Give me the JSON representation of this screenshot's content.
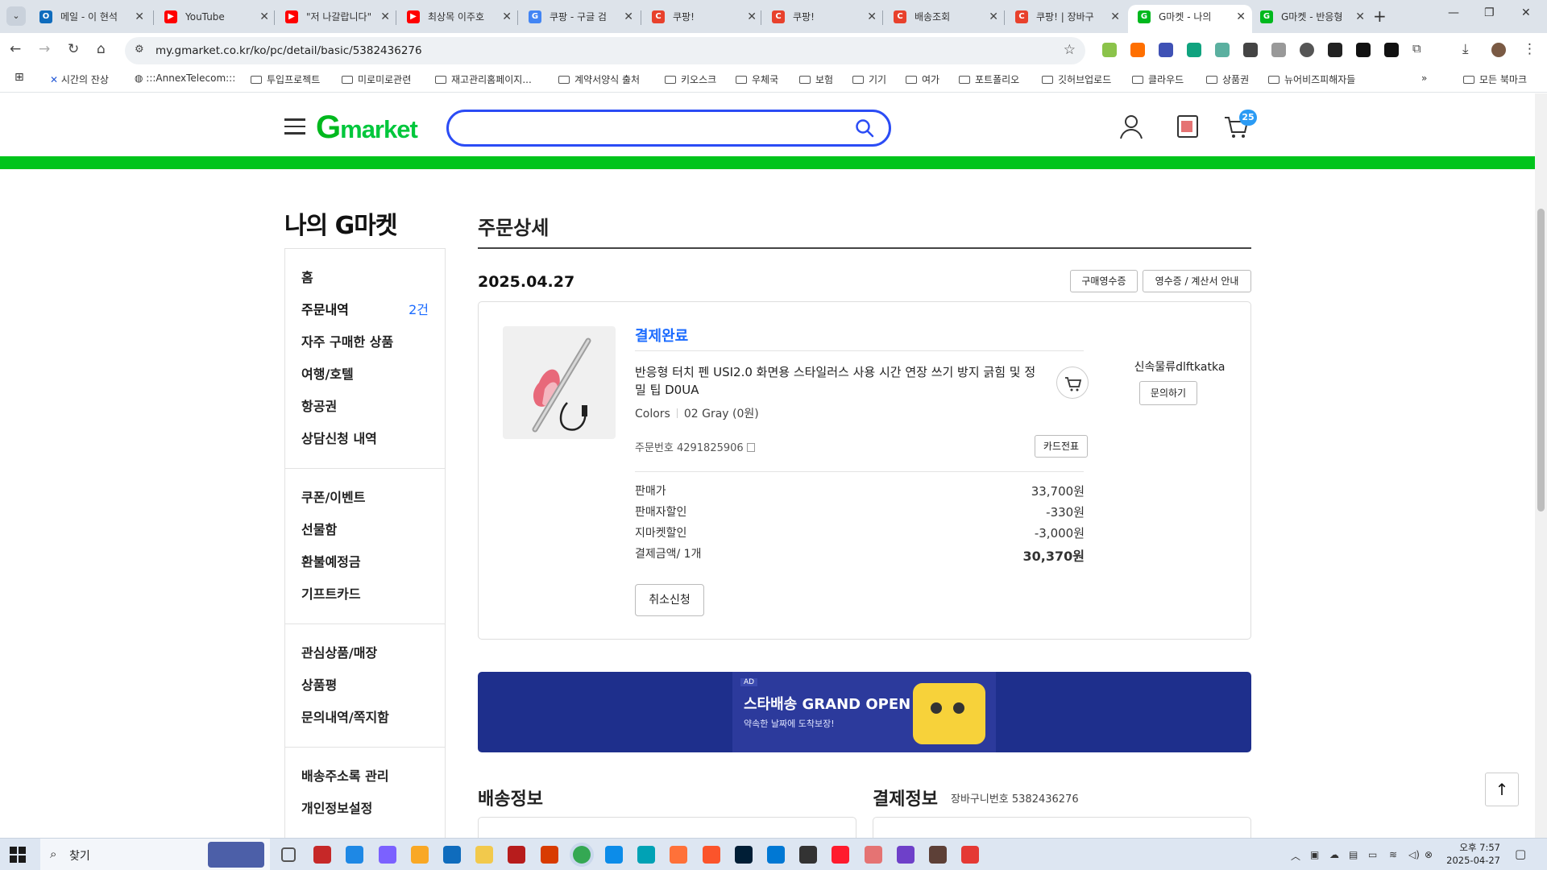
{
  "browser": {
    "tabs": [
      {
        "title": "메일 - 이 현석",
        "fav": "O",
        "color": "#0f6cbd"
      },
      {
        "title": "YouTube",
        "fav": "▶",
        "color": "#ff0000"
      },
      {
        "title": "\"저 나갈랍니다\"",
        "fav": "▶",
        "color": "#ff0000"
      },
      {
        "title": "최상목 이주호",
        "fav": "▶",
        "color": "#ff0000"
      },
      {
        "title": "쿠팡 - 구글 검",
        "fav": "G",
        "color": "#4285f4"
      },
      {
        "title": "쿠팡!",
        "fav": "C",
        "color": "#e8412c"
      },
      {
        "title": "쿠팡!",
        "fav": "C",
        "color": "#e8412c"
      },
      {
        "title": "배송조회",
        "fav": "C",
        "color": "#e8412c"
      },
      {
        "title": "쿠팡! | 장바구",
        "fav": "C",
        "color": "#e8412c"
      },
      {
        "title": "G마켓 - 나의 ",
        "fav": "G",
        "color": "#00b81d"
      },
      {
        "title": "G마켓 - 반응형",
        "fav": "G",
        "color": "#00b81d"
      }
    ],
    "url": "my.gmarket.co.kr/ko/pc/detail/basic/5382436276",
    "bookmarks": [
      "시간의 잔상",
      ":::AnnexTelecom:::",
      "투입프로젝트",
      "미로미로관련",
      "재고관리홈페이지...",
      "계약서양식 출처",
      "키오스크",
      "우체국",
      "보험",
      "기기",
      "여가",
      "포트폴리오",
      "깃허브업로드",
      "클라우드",
      "상품권",
      "뉴어비즈피해자들"
    ],
    "all_bookmarks": "모든 북마크"
  },
  "header": {
    "logo": "Gmarket",
    "search_placeholder": "",
    "cart_count": "25"
  },
  "sidebar": {
    "title": "나의 G마켓",
    "groups": [
      [
        {
          "label": "홈"
        },
        {
          "label": "주문내역",
          "count": "2건"
        },
        {
          "label": "자주 구매한 상품"
        },
        {
          "label": "여행/호텔"
        },
        {
          "label": "항공권"
        },
        {
          "label": "상담신청 내역"
        }
      ],
      [
        {
          "label": "쿠폰/이벤트"
        },
        {
          "label": "선물함"
        },
        {
          "label": "환불예정금"
        },
        {
          "label": "기프트카드"
        }
      ],
      [
        {
          "label": "관심상품/매장"
        },
        {
          "label": "상품평"
        },
        {
          "label": "문의내역/쪽지함"
        }
      ],
      [
        {
          "label": "배송주소록 관리"
        },
        {
          "label": "개인정보설정"
        }
      ]
    ]
  },
  "order": {
    "page_title": "주문상세",
    "date": "2025.04.27",
    "receipt_btn": "구매영수증",
    "tax_btn": "영수증 / 계산서 안내",
    "status": "결제완료",
    "product_name": "반응형 터치 펜 USI2.0 화면용 스타일러스 사용 시간 연장 쓰기 방지 긁힘 및 정밀 팁 D0UA",
    "option_label": "Colors",
    "option_value": "02 Gray (0원)",
    "order_no": "주문번호 4291825906",
    "card_slip_btn": "카드전표",
    "prices": [
      {
        "label": "판매가",
        "value": "33,700원"
      },
      {
        "label": "판매자할인",
        "value": "-330원"
      },
      {
        "label": "지마켓할인",
        "value": "-3,000원"
      },
      {
        "label": "결제금액/ 1개",
        "value": "30,370원"
      }
    ],
    "cancel_btn": "취소신청",
    "seller": "신속물류dlftkatka",
    "ask_btn": "문의하기"
  },
  "banner": {
    "ad": "AD",
    "title": "스타배송 GRAND OPEN",
    "subtitle": "약속한 날짜에 도착보장!"
  },
  "sections": {
    "delivery": "배송정보",
    "payment": "결제정보",
    "basket_no": "장바구니번호 5382436276"
  },
  "taskbar": {
    "search": "찾기",
    "time": "오후 7:57",
    "date": "2025-04-27"
  }
}
